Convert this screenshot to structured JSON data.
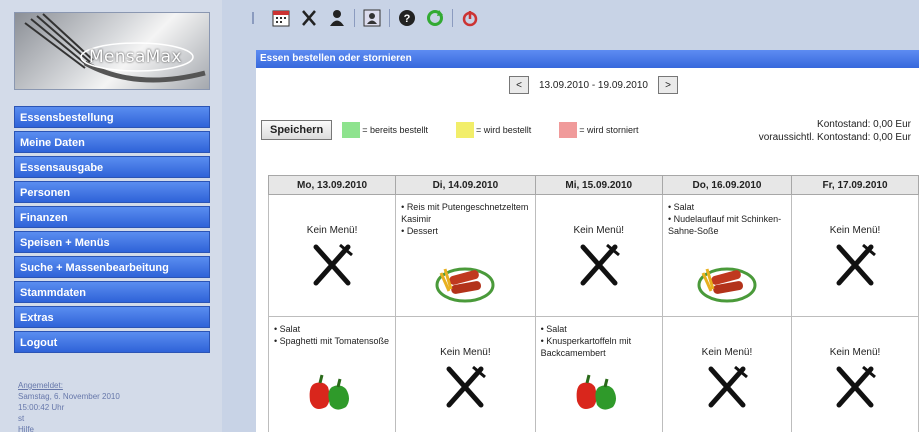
{
  "app": {
    "logo_text": "MensaMax"
  },
  "sidebar": {
    "items": [
      {
        "label": "Essensbestellung"
      },
      {
        "label": "Meine Daten"
      },
      {
        "label": "Essensausgabe"
      },
      {
        "label": "Personen"
      },
      {
        "label": "Finanzen"
      },
      {
        "label": "Speisen + Menüs"
      },
      {
        "label": "Suche + Massenbearbeitung"
      },
      {
        "label": "Stammdaten"
      },
      {
        "label": "Extras"
      },
      {
        "label": "Logout"
      }
    ],
    "login": {
      "label": "Angemeldet:",
      "date": "Samstag, 6. November 2010",
      "time": "15:00:42 Uhr",
      "user": "st",
      "extra": "Hilfe"
    }
  },
  "toolbar": {
    "icons": [
      "calendar-icon",
      "cutlery-icon",
      "user-icon",
      "contact-card-icon",
      "help-icon",
      "refresh-icon",
      "power-icon"
    ]
  },
  "main": {
    "title": "Essen bestellen oder stornieren",
    "week": {
      "prev": "<",
      "range": "13.09.2010 - 19.09.2010",
      "next": ">"
    },
    "save_label": "Speichern",
    "legend": [
      {
        "label": "= bereits bestellt",
        "color": "#8ee38e"
      },
      {
        "label": "= wird bestellt",
        "color": "#f2ee6a"
      },
      {
        "label": "= wird storniert",
        "color": "#f09a9a"
      }
    ],
    "konto": {
      "line1": "Kontostand: 0,00 Eur",
      "line2": "voraussichtl. Kontostand: 0,00 Eur"
    },
    "days": [
      "Mo, 13.09.2010",
      "Di, 14.09.2010",
      "Mi, 15.09.2010",
      "Do, 16.09.2010",
      "Fr, 17.09.2010"
    ],
    "no_menu": "Kein Menü!",
    "rows": [
      [
        {
          "type": "none"
        },
        {
          "type": "menu",
          "items": [
            "Reis mit Putengeschnetzeltem Kasimir",
            "Dessert"
          ],
          "image": "sausage-plate-icon"
        },
        {
          "type": "none"
        },
        {
          "type": "menu",
          "items": [
            "Salat",
            "Nudelauflauf mit Schinken-Sahne-Soße"
          ],
          "image": "sausage-plate-icon"
        },
        {
          "type": "none"
        }
      ],
      [
        {
          "type": "menu",
          "items": [
            "Salat",
            "Spaghetti mit Tomatensoße"
          ],
          "image": "peppers-icon"
        },
        {
          "type": "none"
        },
        {
          "type": "menu",
          "items": [
            "Salat",
            "Knusperkartoffeln mit Backcamembert"
          ],
          "image": "peppers-icon"
        },
        {
          "type": "none"
        },
        {
          "type": "none"
        }
      ]
    ]
  }
}
